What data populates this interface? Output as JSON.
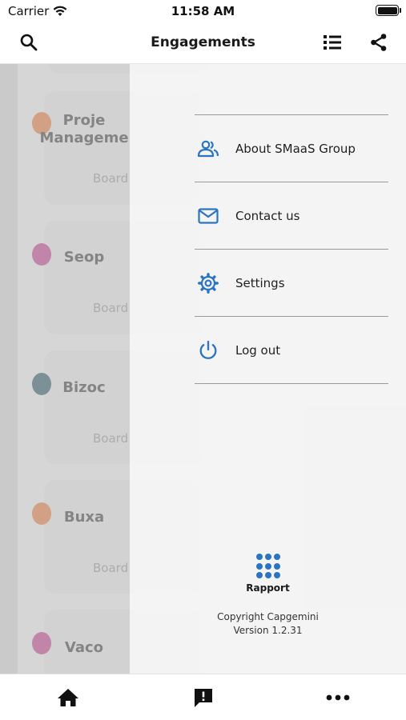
{
  "status_bar": {
    "carrier": "Carrier",
    "time": "11:58 AM"
  },
  "header": {
    "title": "Engagements",
    "icons": [
      "search-icon",
      "list-icon",
      "share-icon"
    ]
  },
  "background_cards": [
    {
      "title": "Proje\nManageme",
      "subtitle": "Board",
      "accent": "#e0966c"
    },
    {
      "title": "Seop",
      "subtitle": "Board",
      "accent": "#c96ca5"
    },
    {
      "title": "Bizoc",
      "subtitle": "Board",
      "accent": "#5e7f87"
    },
    {
      "title": "Buxa",
      "subtitle": "Board",
      "accent": "#e0966c"
    },
    {
      "title": "Vaco",
      "subtitle": "",
      "accent": "#c96ca5"
    }
  ],
  "drawer": {
    "items": [
      {
        "label": "About SMaaS Group",
        "icon": "group-icon"
      },
      {
        "label": "Contact us",
        "icon": "mail-icon"
      },
      {
        "label": "Settings",
        "icon": "gear-icon"
      },
      {
        "label": "Log out",
        "icon": "power-icon"
      }
    ],
    "brand": "Rapport",
    "copyright": "Copyright Capgemini",
    "version": "Version 1.2.31"
  },
  "tabbar": {
    "icons": [
      "home-icon",
      "alert-icon",
      "more-icon"
    ]
  },
  "colors": {
    "accent": "#2b74c0",
    "divider": "#9a9a9a"
  }
}
